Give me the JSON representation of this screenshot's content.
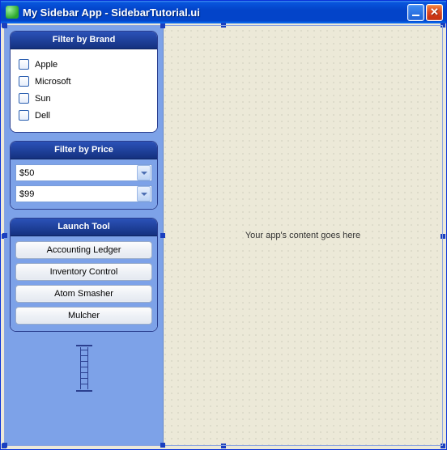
{
  "window": {
    "title": "My Sidebar App - SidebarTutorial.ui"
  },
  "sidebar": {
    "brand_panel": {
      "title": "Filter by Brand",
      "items": [
        {
          "label": "Apple"
        },
        {
          "label": "Microsoft"
        },
        {
          "label": "Sun"
        },
        {
          "label": "Dell"
        }
      ]
    },
    "price_panel": {
      "title": "Filter by Price",
      "from_value": "$50",
      "to_value": "$99"
    },
    "tool_panel": {
      "title": "Launch Tool",
      "buttons": [
        {
          "label": "Accounting Ledger"
        },
        {
          "label": "Inventory Control"
        },
        {
          "label": "Atom Smasher"
        },
        {
          "label": "Mulcher"
        }
      ]
    }
  },
  "content": {
    "placeholder": "Your app's content goes here"
  }
}
